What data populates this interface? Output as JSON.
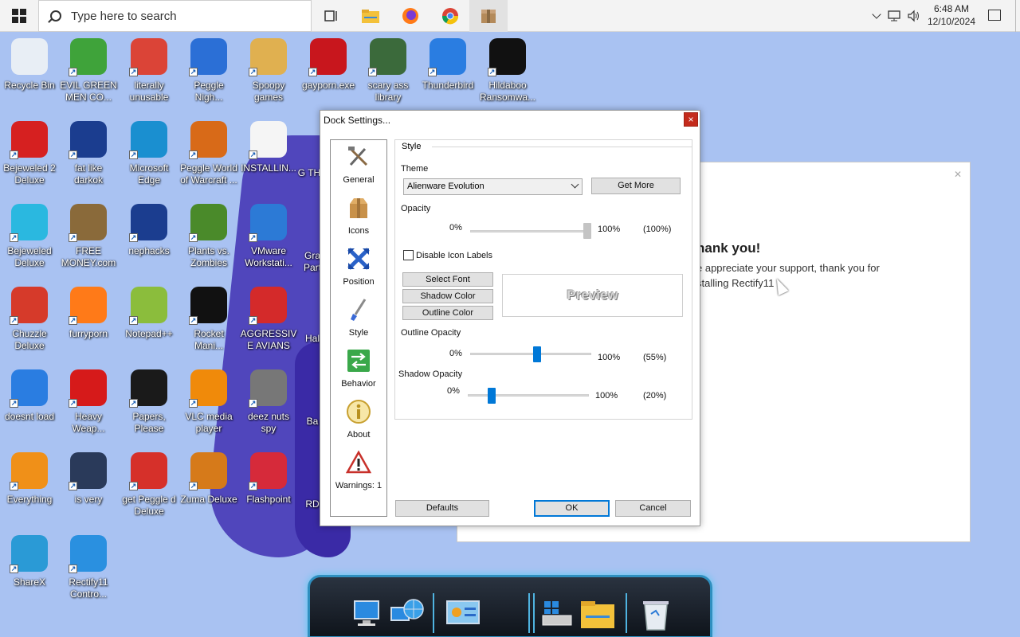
{
  "taskbar": {
    "search_placeholder": "Type here to search",
    "clock_time": "6:48 AM",
    "clock_date": "12/10/2024",
    "pinned": [
      "task-view-icon",
      "file-explorer-icon",
      "firefox-icon",
      "chrome-icon",
      "package-icon"
    ]
  },
  "desktop_icons": [
    {
      "label": "Recycle Bin",
      "icon": "recycle-bin-icon",
      "color": "#e8eef5"
    },
    {
      "label": "EVIL GREEN MEN CO...",
      "icon": "people-icon",
      "color": "#3fa33a"
    },
    {
      "label": "literally unusable",
      "icon": "chrome-icon",
      "color": "#db4437"
    },
    {
      "label": "Peggle Nigh...",
      "icon": "peggle-icon",
      "color": "#2b6fd6"
    },
    {
      "label": "Spoopy games",
      "icon": "folder-icon",
      "color": "#e0b050"
    },
    {
      "label": "gayporn.exe",
      "icon": "flash-icon",
      "color": "#c8161d"
    },
    {
      "label": "scary ass library",
      "icon": "library-icon",
      "color": "#3b6a3b"
    },
    {
      "label": "Thunderbird",
      "icon": "thunderbird-icon",
      "color": "#2a7de1"
    },
    {
      "label": "Hildaboo Ransomwa...",
      "icon": "yashma-icon",
      "color": "#111111"
    },
    {
      "label": "Bejeweled 2 Deluxe",
      "icon": "bejeweled2-icon",
      "color": "#d62020"
    },
    {
      "label": "fat like darkok",
      "icon": "mpi-icon",
      "color": "#1b3d8f"
    },
    {
      "label": "Microsoft Edge",
      "icon": "edge-icon",
      "color": "#1a8fd0"
    },
    {
      "label": "Peggle World of Warcraft ...",
      "icon": "peggle-icon",
      "color": "#d86a18"
    },
    {
      "label": "INSTALLIN...",
      "icon": "text-file-icon",
      "color": "#f5f5f5"
    },
    {
      "label": "Bejeweled Deluxe",
      "icon": "diamond-icon",
      "color": "#2ab8e0"
    },
    {
      "label": "FREE MONEY.com",
      "icon": "money-bag-icon",
      "color": "#8a6a3a"
    },
    {
      "label": "nephacks",
      "icon": "mpi-icon",
      "color": "#1b3d8f"
    },
    {
      "label": "Plants vs. Zombies",
      "icon": "pvz-icon",
      "color": "#4a8a2a"
    },
    {
      "label": "VMware Workstati...",
      "icon": "vmware-icon",
      "color": "#2c7ad6"
    },
    {
      "label": "Chuzzle Deluxe",
      "icon": "chuzzle-icon",
      "color": "#d63a2a"
    },
    {
      "label": "furryporn",
      "icon": "firefox-icon",
      "color": "#ff7a18"
    },
    {
      "label": "Notepad++",
      "icon": "notepad-icon",
      "color": "#8bbd3c"
    },
    {
      "label": "Rocket Mani...",
      "icon": "rocket-icon",
      "color": "#111111"
    },
    {
      "label": "AGGRESSIVE AVIANS",
      "icon": "angry-bird-icon",
      "color": "#d42a2a"
    },
    {
      "label": "doesnt load",
      "icon": "thunderbird-icon",
      "color": "#2a7de1"
    },
    {
      "label": "Heavy Weap...",
      "icon": "radiation-icon",
      "color": "#d61a1a"
    },
    {
      "label": "Papers, Please",
      "icon": "papers-icon",
      "color": "#1a1a1a"
    },
    {
      "label": "VLC media player",
      "icon": "vlc-icon",
      "color": "#f08a0a"
    },
    {
      "label": "deez nuts spy",
      "icon": "stack-icon",
      "color": "#777777"
    },
    {
      "label": "Everything",
      "icon": "everything-icon",
      "color": "#f09018"
    },
    {
      "label": "is very",
      "icon": "mpi-shield-icon",
      "color": "#2a3a5a"
    },
    {
      "label": "get Peggle d Deluxe",
      "icon": "peggle-icon",
      "color": "#d6302a"
    },
    {
      "label": "Zuma Deluxe",
      "icon": "zuma-icon",
      "color": "#d67a1a"
    },
    {
      "label": "Flashpoint",
      "icon": "flashpoint-icon",
      "color": "#d62a3a"
    },
    {
      "label": "ShareX",
      "icon": "sharex-icon",
      "color": "#2a9ad6"
    },
    {
      "label": "Rectify11 Contro...",
      "icon": "rectify-icon",
      "color": "#2a90e0"
    }
  ],
  "partial_icons": [
    "G THE",
    "Gra Part",
    "Hal",
    "Ba",
    "RD"
  ],
  "rectify_window": {
    "heading": "hank you!",
    "message_line1": "e appreciate your support, thank you for",
    "message_line2": "stalling Rectify11"
  },
  "dialog": {
    "title": "Dock Settings...",
    "close": "×",
    "nav": [
      {
        "label": "General",
        "icon": "tools-icon"
      },
      {
        "label": "Icons",
        "icon": "box-icon"
      },
      {
        "label": "Position",
        "icon": "position-arrows-icon"
      },
      {
        "label": "Style",
        "icon": "brush-icon"
      },
      {
        "label": "Behavior",
        "icon": "behavior-arrows-icon"
      },
      {
        "label": "About",
        "icon": "info-icon"
      },
      {
        "label": "Warnings: 1",
        "icon": "warning-icon"
      }
    ],
    "group_title": "Style",
    "theme_label": "Theme",
    "theme_value": "Alienware Evolution",
    "get_more": "Get More",
    "opacity_label": "Opacity",
    "opacity_min": "0%",
    "opacity_max": "100%",
    "opacity_value": "(100%)",
    "opacity_fraction": 1.0,
    "disable_labels": "Disable Icon Labels",
    "disable_labels_checked": false,
    "select_font": "Select Font",
    "shadow_color": "Shadow Color",
    "outline_color": "Outline Color",
    "preview": "Preview",
    "outline_opacity_label": "Outline Opacity",
    "outline_min": "0%",
    "outline_max": "100%",
    "outline_value": "(55%)",
    "outline_fraction": 0.55,
    "shadow_opacity_label": "Shadow Opacity",
    "shadow_min": "0%",
    "shadow_max": "100%",
    "shadow_value": "(20%)",
    "shadow_fraction": 0.2,
    "defaults": "Defaults",
    "ok": "OK",
    "cancel": "Cancel"
  },
  "dock": {
    "items": [
      "computer-icon",
      "network-icon",
      "control-panel-icon",
      "windows-drive-icon",
      "folder-icon",
      "recycle-bin-icon"
    ]
  },
  "colors": {
    "desktop": "#a9c2f2",
    "accent": "#0078d7",
    "close_red": "#c42b1c",
    "dock_glow": "#59c8f0"
  }
}
